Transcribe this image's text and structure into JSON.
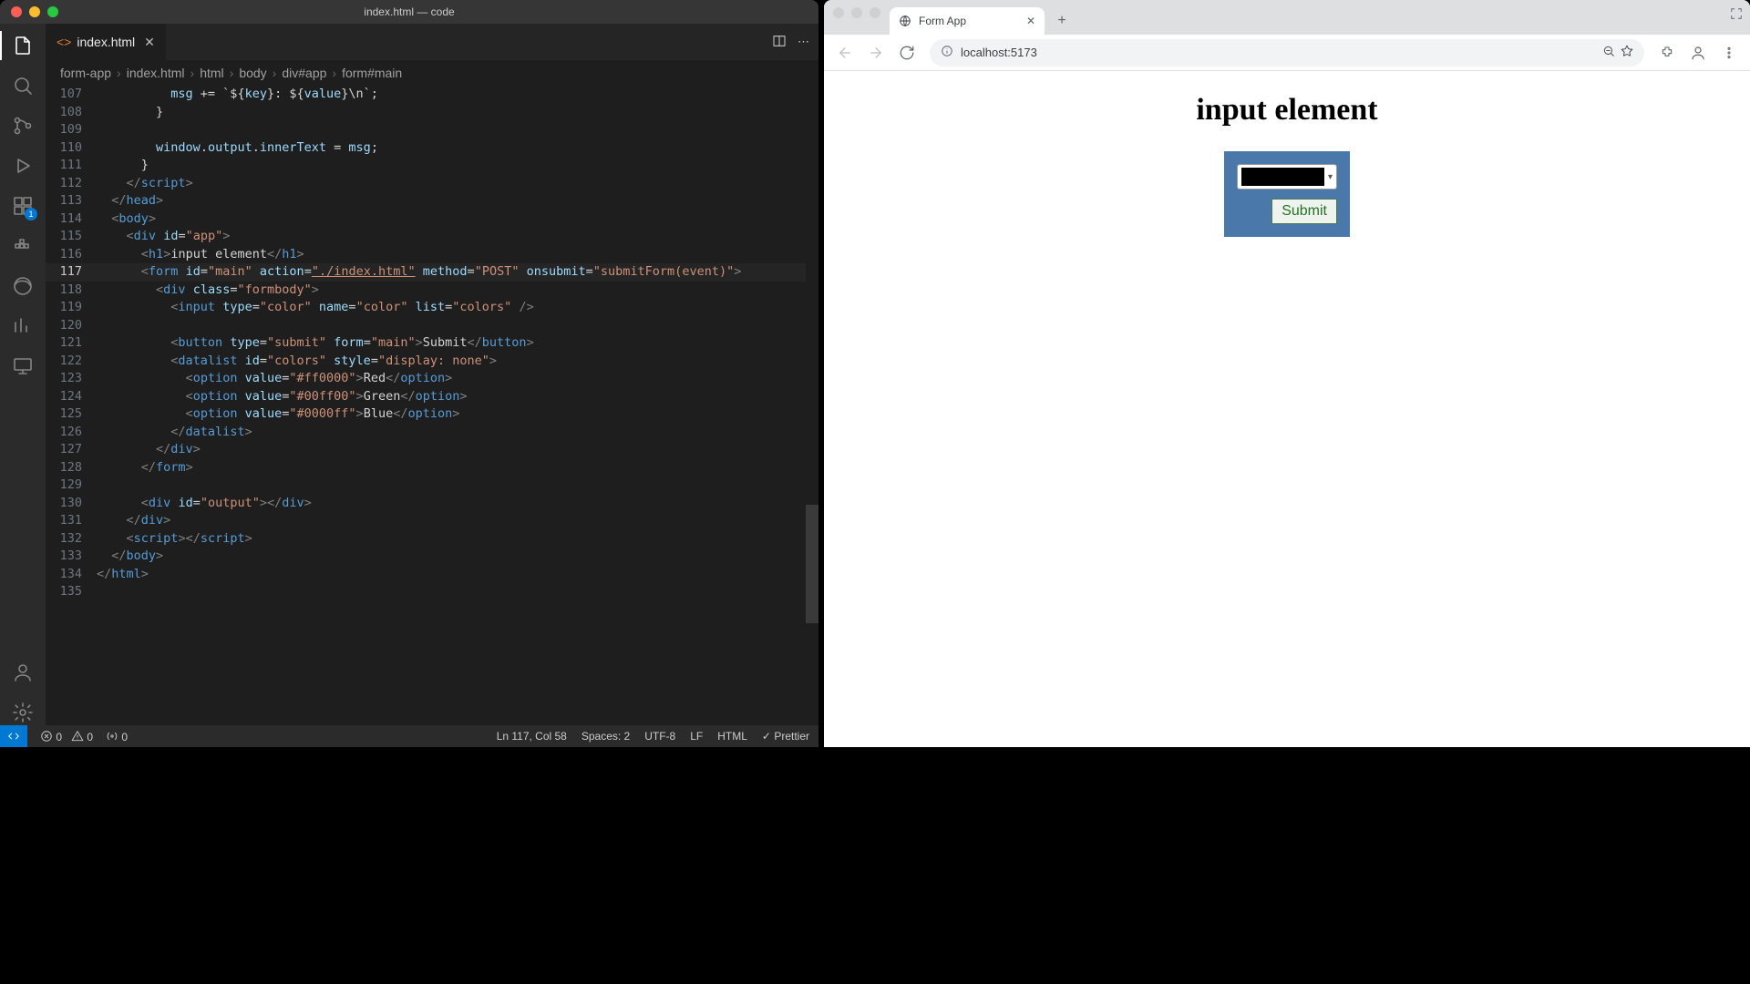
{
  "vscode": {
    "window_title": "index.html — code",
    "tab": {
      "filename": "index.html"
    },
    "breadcrumbs": [
      "form-app",
      "index.html",
      "html",
      "body",
      "div#app",
      "form#main"
    ],
    "activity_badge": "1",
    "status": {
      "errors": "0",
      "warnings": "0",
      "ports": "0",
      "cursor": "Ln 117, Col 58",
      "spaces": "Spaces: 2",
      "encoding": "UTF-8",
      "eol": "LF",
      "lang": "HTML",
      "formatter": "Prettier"
    },
    "lines": [
      {
        "n": "107",
        "indent": 10,
        "tokens": [
          [
            "var",
            "msg"
          ],
          [
            "txt",
            " += `${"
          ],
          [
            "var",
            "key"
          ],
          [
            "txt",
            "}: ${"
          ],
          [
            "var",
            "value"
          ],
          [
            "txt",
            "}\\n`;"
          ]
        ]
      },
      {
        "n": "108",
        "indent": 8,
        "tokens": [
          [
            "txt",
            "}"
          ]
        ]
      },
      {
        "n": "109",
        "indent": 0,
        "tokens": []
      },
      {
        "n": "110",
        "indent": 8,
        "tokens": [
          [
            "var",
            "window"
          ],
          [
            "txt",
            "."
          ],
          [
            "var",
            "output"
          ],
          [
            "txt",
            "."
          ],
          [
            "var",
            "innerText"
          ],
          [
            "txt",
            " = "
          ],
          [
            "var",
            "msg"
          ],
          [
            "txt",
            ";"
          ]
        ]
      },
      {
        "n": "111",
        "indent": 6,
        "tokens": [
          [
            "txt",
            "}"
          ]
        ]
      },
      {
        "n": "112",
        "indent": 4,
        "tokens": [
          [
            "pun",
            "</"
          ],
          [
            "tag",
            "script"
          ],
          [
            "pun",
            ">"
          ]
        ]
      },
      {
        "n": "113",
        "indent": 2,
        "tokens": [
          [
            "pun",
            "</"
          ],
          [
            "tag",
            "head"
          ],
          [
            "pun",
            ">"
          ]
        ]
      },
      {
        "n": "114",
        "indent": 2,
        "tokens": [
          [
            "pun",
            "<"
          ],
          [
            "tag",
            "body"
          ],
          [
            "pun",
            ">"
          ]
        ]
      },
      {
        "n": "115",
        "indent": 4,
        "tokens": [
          [
            "pun",
            "<"
          ],
          [
            "tag",
            "div"
          ],
          [
            "txt",
            " "
          ],
          [
            "attr",
            "id"
          ],
          [
            "txt",
            "="
          ],
          [
            "str",
            "\"app\""
          ],
          [
            "pun",
            ">"
          ]
        ]
      },
      {
        "n": "116",
        "indent": 6,
        "tokens": [
          [
            "pun",
            "<"
          ],
          [
            "tag",
            "h1"
          ],
          [
            "pun",
            ">"
          ],
          [
            "txt",
            "input element"
          ],
          [
            "pun",
            "</"
          ],
          [
            "tag",
            "h1"
          ],
          [
            "pun",
            ">"
          ]
        ]
      },
      {
        "n": "117",
        "indent": 6,
        "active": true,
        "tokens": [
          [
            "pun",
            "<"
          ],
          [
            "tag",
            "form"
          ],
          [
            "txt",
            " "
          ],
          [
            "attr",
            "id"
          ],
          [
            "txt",
            "="
          ],
          [
            "str",
            "\"main\""
          ],
          [
            "txt",
            " "
          ],
          [
            "attr",
            "action"
          ],
          [
            "txt",
            "="
          ],
          [
            "str-u",
            "\"./index.html\""
          ],
          [
            "txt",
            " "
          ],
          [
            "attr",
            "method"
          ],
          [
            "txt",
            "="
          ],
          [
            "str",
            "\"POST\""
          ],
          [
            "txt",
            " "
          ],
          [
            "attr",
            "onsubmit"
          ],
          [
            "txt",
            "="
          ],
          [
            "str",
            "\"submitForm(event)\""
          ],
          [
            "pun",
            ">"
          ]
        ]
      },
      {
        "n": "118",
        "indent": 8,
        "tokens": [
          [
            "pun",
            "<"
          ],
          [
            "tag",
            "div"
          ],
          [
            "txt",
            " "
          ],
          [
            "attr",
            "class"
          ],
          [
            "txt",
            "="
          ],
          [
            "str",
            "\"formbody\""
          ],
          [
            "pun",
            ">"
          ]
        ]
      },
      {
        "n": "119",
        "indent": 10,
        "tokens": [
          [
            "pun",
            "<"
          ],
          [
            "tag",
            "input"
          ],
          [
            "txt",
            " "
          ],
          [
            "attr",
            "type"
          ],
          [
            "txt",
            "="
          ],
          [
            "str",
            "\"color\""
          ],
          [
            "txt",
            " "
          ],
          [
            "attr",
            "name"
          ],
          [
            "txt",
            "="
          ],
          [
            "str",
            "\"color\""
          ],
          [
            "txt",
            " "
          ],
          [
            "attr",
            "list"
          ],
          [
            "txt",
            "="
          ],
          [
            "str",
            "\"colors\""
          ],
          [
            "txt",
            " "
          ],
          [
            "pun",
            "/>"
          ]
        ]
      },
      {
        "n": "120",
        "indent": 0,
        "tokens": []
      },
      {
        "n": "121",
        "indent": 10,
        "tokens": [
          [
            "pun",
            "<"
          ],
          [
            "tag",
            "button"
          ],
          [
            "txt",
            " "
          ],
          [
            "attr",
            "type"
          ],
          [
            "txt",
            "="
          ],
          [
            "str",
            "\"submit\""
          ],
          [
            "txt",
            " "
          ],
          [
            "attr",
            "form"
          ],
          [
            "txt",
            "="
          ],
          [
            "str",
            "\"main\""
          ],
          [
            "pun",
            ">"
          ],
          [
            "txt",
            "Submit"
          ],
          [
            "pun",
            "</"
          ],
          [
            "tag",
            "button"
          ],
          [
            "pun",
            ">"
          ]
        ]
      },
      {
        "n": "122",
        "indent": 10,
        "tokens": [
          [
            "pun",
            "<"
          ],
          [
            "tag",
            "datalist"
          ],
          [
            "txt",
            " "
          ],
          [
            "attr",
            "id"
          ],
          [
            "txt",
            "="
          ],
          [
            "str",
            "\"colors\""
          ],
          [
            "txt",
            " "
          ],
          [
            "attr",
            "style"
          ],
          [
            "txt",
            "="
          ],
          [
            "str",
            "\"display: none\""
          ],
          [
            "pun",
            ">"
          ]
        ]
      },
      {
        "n": "123",
        "indent": 12,
        "tokens": [
          [
            "pun",
            "<"
          ],
          [
            "tag",
            "option"
          ],
          [
            "txt",
            " "
          ],
          [
            "attr",
            "value"
          ],
          [
            "txt",
            "="
          ],
          [
            "str",
            "\"#ff0000\""
          ],
          [
            "pun",
            ">"
          ],
          [
            "txt",
            "Red"
          ],
          [
            "pun",
            "</"
          ],
          [
            "tag",
            "option"
          ],
          [
            "pun",
            ">"
          ]
        ]
      },
      {
        "n": "124",
        "indent": 12,
        "tokens": [
          [
            "pun",
            "<"
          ],
          [
            "tag",
            "option"
          ],
          [
            "txt",
            " "
          ],
          [
            "attr",
            "value"
          ],
          [
            "txt",
            "="
          ],
          [
            "str",
            "\"#00ff00\""
          ],
          [
            "pun",
            ">"
          ],
          [
            "txt",
            "Green"
          ],
          [
            "pun",
            "</"
          ],
          [
            "tag",
            "option"
          ],
          [
            "pun",
            ">"
          ]
        ]
      },
      {
        "n": "125",
        "indent": 12,
        "tokens": [
          [
            "pun",
            "<"
          ],
          [
            "tag",
            "option"
          ],
          [
            "txt",
            " "
          ],
          [
            "attr",
            "value"
          ],
          [
            "txt",
            "="
          ],
          [
            "str",
            "\"#0000ff\""
          ],
          [
            "pun",
            ">"
          ],
          [
            "txt",
            "Blue"
          ],
          [
            "pun",
            "</"
          ],
          [
            "tag",
            "option"
          ],
          [
            "pun",
            ">"
          ]
        ]
      },
      {
        "n": "126",
        "indent": 10,
        "tokens": [
          [
            "pun",
            "</"
          ],
          [
            "tag",
            "datalist"
          ],
          [
            "pun",
            ">"
          ]
        ]
      },
      {
        "n": "127",
        "indent": 8,
        "tokens": [
          [
            "pun",
            "</"
          ],
          [
            "tag",
            "div"
          ],
          [
            "pun",
            ">"
          ]
        ]
      },
      {
        "n": "128",
        "indent": 6,
        "tokens": [
          [
            "pun",
            "</"
          ],
          [
            "tag",
            "form"
          ],
          [
            "pun",
            ">"
          ]
        ]
      },
      {
        "n": "129",
        "indent": 0,
        "tokens": []
      },
      {
        "n": "130",
        "indent": 6,
        "tokens": [
          [
            "pun",
            "<"
          ],
          [
            "tag",
            "div"
          ],
          [
            "txt",
            " "
          ],
          [
            "attr",
            "id"
          ],
          [
            "txt",
            "="
          ],
          [
            "str",
            "\"output\""
          ],
          [
            "pun",
            "></"
          ],
          [
            "tag",
            "div"
          ],
          [
            "pun",
            ">"
          ]
        ]
      },
      {
        "n": "131",
        "indent": 4,
        "tokens": [
          [
            "pun",
            "</"
          ],
          [
            "tag",
            "div"
          ],
          [
            "pun",
            ">"
          ]
        ]
      },
      {
        "n": "132",
        "indent": 4,
        "tokens": [
          [
            "pun",
            "<"
          ],
          [
            "tag",
            "script"
          ],
          [
            "pun",
            "></"
          ],
          [
            "tag",
            "script"
          ],
          [
            "pun",
            ">"
          ]
        ]
      },
      {
        "n": "133",
        "indent": 2,
        "tokens": [
          [
            "pun",
            "</"
          ],
          [
            "tag",
            "body"
          ],
          [
            "pun",
            ">"
          ]
        ]
      },
      {
        "n": "134",
        "indent": 0,
        "tokens": [
          [
            "pun",
            "</"
          ],
          [
            "tag",
            "html"
          ],
          [
            "pun",
            ">"
          ]
        ]
      },
      {
        "n": "135",
        "indent": 0,
        "tokens": []
      }
    ]
  },
  "chrome": {
    "tab_title": "Form App",
    "url": "localhost:5173",
    "page": {
      "heading": "input element",
      "submit": "Submit",
      "color_value": "#000000"
    }
  }
}
